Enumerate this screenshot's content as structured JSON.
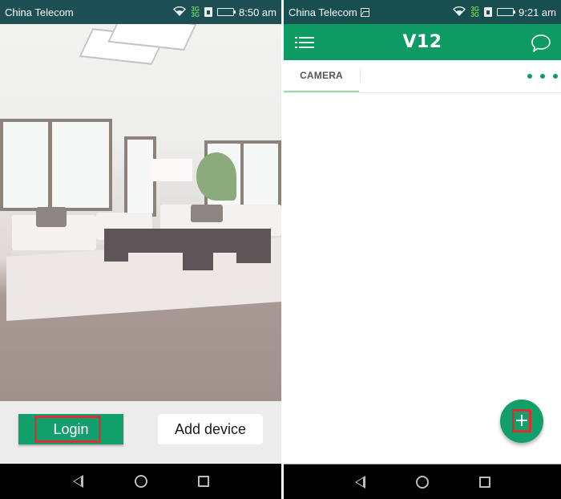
{
  "left_screen": {
    "status_bar": {
      "carrier": "China Telecom",
      "network_label": "3G",
      "time": "8:50 am",
      "icons": [
        "wifi-icon",
        "signal-icon",
        "sim-icon",
        "battery-icon"
      ]
    },
    "background_image": "living-room-photo",
    "buttons": {
      "login_label": "Login",
      "add_device_label": "Add device"
    },
    "nav_bar": {
      "back": "back-icon",
      "home": "home-icon",
      "recents": "recents-icon"
    }
  },
  "right_screen": {
    "status_bar": {
      "carrier": "China Telecom",
      "network_label": "3G",
      "time": "9:21 am",
      "icons": [
        "gallery-notification-icon",
        "wifi-icon",
        "signal-icon",
        "sim-icon",
        "battery-icon"
      ]
    },
    "app_bar": {
      "title": "V12",
      "left_icon": "menu-icon",
      "right_icon": "chat-icon"
    },
    "tabs": [
      {
        "label": "CAMERA",
        "active": true
      }
    ],
    "more_icon": "more-dots-icon",
    "fab": {
      "label": "+",
      "icon": "add-icon"
    },
    "nav_bar": {
      "back": "back-icon",
      "home": "home-icon",
      "recents": "recents-icon"
    }
  },
  "colors": {
    "brand_green": "#0e9b63",
    "status_bar": "#1d4f55",
    "highlight_red": "#e02c33",
    "tab_underline": "#9fdcab"
  }
}
